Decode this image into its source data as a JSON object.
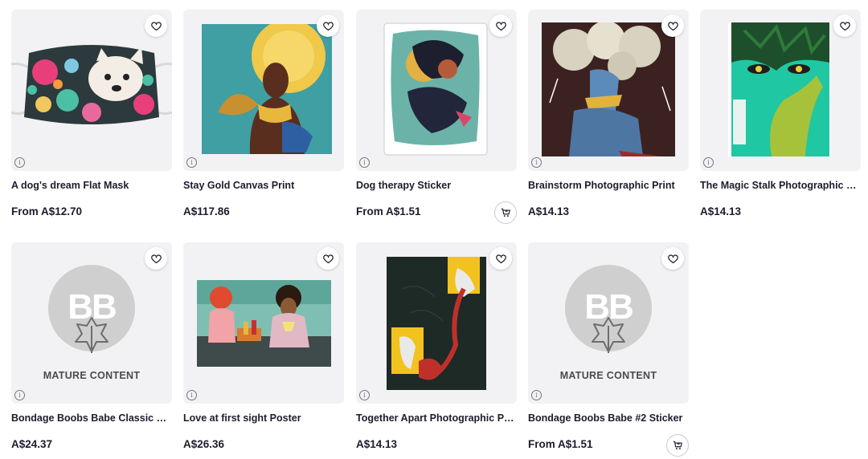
{
  "products": [
    {
      "title": "A dog's dream Flat Mask",
      "price": "From A$12.70",
      "art": "mask-art",
      "has_cart": false
    },
    {
      "title": "Stay Gold Canvas Print",
      "price": "A$117.86",
      "art": "canvas-art",
      "has_cart": false
    },
    {
      "title": "Dog therapy Sticker",
      "price": "From A$1.51",
      "art": "sticker-art",
      "has_cart": true
    },
    {
      "title": "Brainstorm Photographic Print",
      "price": "A$14.13",
      "art": "print-art",
      "has_cart": false
    },
    {
      "title": "The Magic Stalk Photographic Print",
      "price": "A$14.13",
      "art": "stalk-art",
      "has_cart": false
    },
    {
      "title": "Bondage Boobs Babe Classic T-Shirt",
      "price": "A$24.37",
      "art": "mature-placeholder",
      "has_cart": false
    },
    {
      "title": "Love at first sight Poster",
      "price": "A$26.36",
      "art": "poster-art",
      "has_cart": false
    },
    {
      "title": "Together Apart Photographic Print",
      "price": "A$14.13",
      "art": "together-art",
      "has_cart": false
    },
    {
      "title": "Bondage Boobs Babe #2 Sticker",
      "price": "From A$1.51",
      "art": "mature-placeholder",
      "has_cart": true
    }
  ],
  "mature_label": "MATURE CONTENT",
  "mature_logo": "BB",
  "info_glyph": "i",
  "icons": {
    "favorite": "heart-icon",
    "cart": "add-to-cart-icon",
    "info": "info-icon"
  },
  "colors": {
    "text": "#1c1d2c",
    "thumb_bg": "#f2f2f4",
    "mature_circle": "#cfcfcf"
  }
}
